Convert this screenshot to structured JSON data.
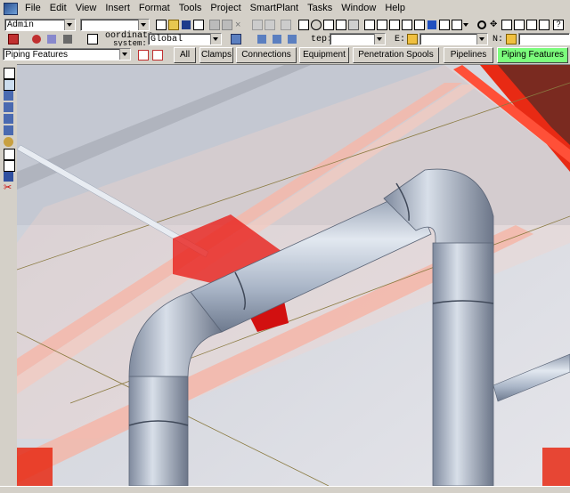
{
  "menu": {
    "items": [
      "File",
      "Edit",
      "View",
      "Insert",
      "Format",
      "Tools",
      "Project",
      "SmartPlant",
      "Tasks",
      "Window",
      "Help"
    ]
  },
  "toolbar1": {
    "user_combo": "Admin",
    "second_combo": ""
  },
  "toolbar2": {
    "coord_label_1": "oordinate",
    "coord_label_2": "system:",
    "coord_value": "Global",
    "step_label": "tep:",
    "step_value": "",
    "e_label": "E:",
    "e_value": "",
    "n_label": "N:",
    "n_value": ""
  },
  "toolbar3": {
    "locate_filter": "Piping Features",
    "buttons": [
      "All",
      "Clamps",
      "Connections",
      "Equipment",
      "Penetration Spools",
      "Pipelines",
      "Piping Features"
    ],
    "active_button": "Piping Features"
  },
  "colors": {
    "chrome": "#d4d0c8",
    "active_filter": "#7cfc7c",
    "pipe": "#a9b6c8",
    "red_volume": "#e8201c"
  },
  "icons": [
    "select-arrow-icon",
    "select-filter-icon",
    "measure-icon",
    "rotate-icon",
    "pan-icon",
    "zoom-icon",
    "fit-icon",
    "route-icon",
    "insert-icon",
    "connect-icon",
    "delete-icon"
  ]
}
